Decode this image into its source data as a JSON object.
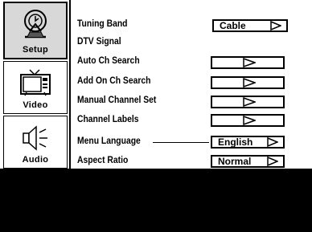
{
  "sidebar": {
    "tabs": [
      {
        "label": "Setup",
        "icon": "satellite-dish-icon",
        "active": true
      },
      {
        "label": "Video",
        "icon": "tv-icon",
        "active": false
      },
      {
        "label": "Audio",
        "icon": "speaker-icon",
        "active": false
      }
    ]
  },
  "menu": {
    "rows": [
      {
        "label": "Tuning Band",
        "control": "Cable"
      },
      {
        "label": "DTV Signal",
        "control": ""
      },
      {
        "label": "Auto Ch Search",
        "control": ""
      },
      {
        "label": "Add On Ch Search",
        "control": ""
      },
      {
        "label": "Manual Channel Set",
        "control": ""
      },
      {
        "label": "Channel Labels",
        "control": ""
      },
      {
        "label": "Menu Language",
        "control": "English"
      },
      {
        "label": "Aspect Ratio",
        "control": "Normal"
      }
    ]
  },
  "colors": {
    "background": "#ffffff",
    "active_tab": "#d8d8d8",
    "overlay": "#000000"
  }
}
